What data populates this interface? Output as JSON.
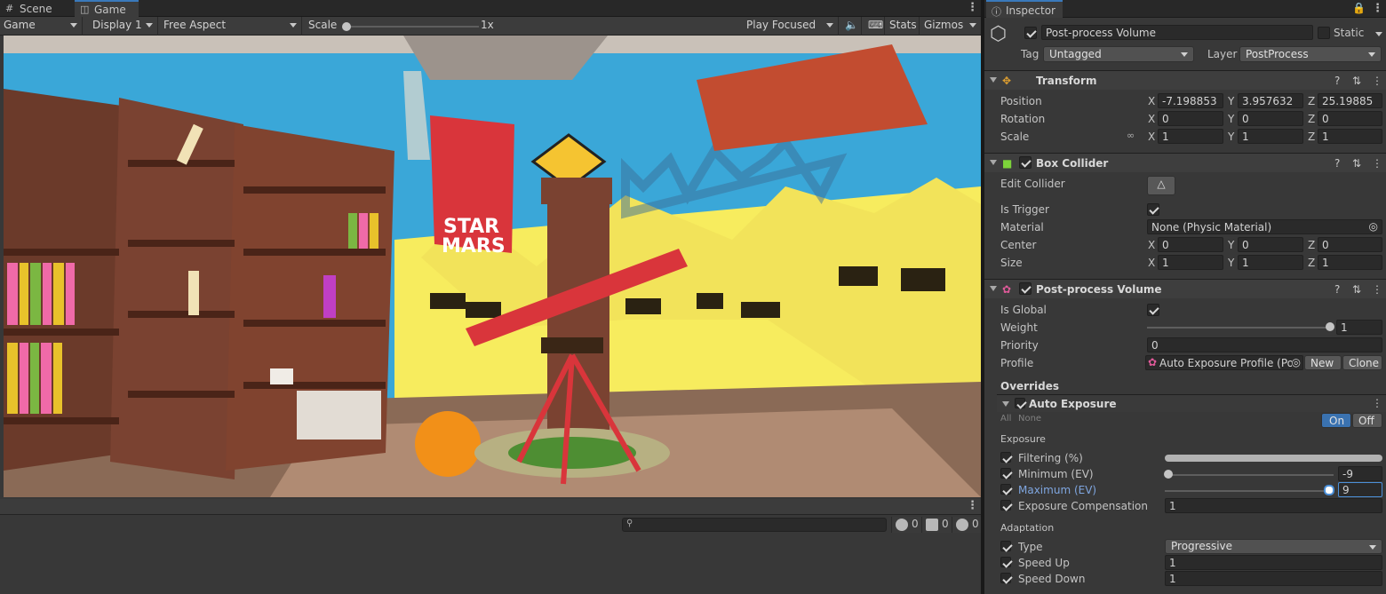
{
  "tabs": [
    {
      "label": "Scene",
      "icon": "grid-icon"
    },
    {
      "label": "Game",
      "icon": "gamepad-icon"
    }
  ],
  "game_toolbar": {
    "display_mode": "Game",
    "display": "Display 1",
    "aspect": "Free Aspect",
    "scale_label": "Scale",
    "scale_value": "1x",
    "play_mode": "Play Focused",
    "stats": "Stats",
    "gizmos": "Gizmos"
  },
  "scene": {
    "banner_line1": "STAR",
    "banner_line2": "MARS"
  },
  "console": {
    "search_placeholder": "",
    "log_count": "0",
    "warning_count": "0",
    "error_count": "0"
  },
  "inspector": {
    "tab": "Inspector",
    "object": {
      "name": "Post-process Volume",
      "static_label": "Static",
      "tag_label": "Tag",
      "tag": "Untagged",
      "layer_label": "Layer",
      "layer": "PostProcess"
    },
    "transform": {
      "title": "Transform",
      "position_label": "Position",
      "rotation_label": "Rotation",
      "scale_label": "Scale",
      "position": {
        "x": "-7.198853",
        "y": "3.957632",
        "z": "25.19885"
      },
      "rotation": {
        "x": "0",
        "y": "0",
        "z": "0"
      },
      "scale": {
        "x": "1",
        "y": "1",
        "z": "1"
      }
    },
    "axes": {
      "x": "X",
      "y": "Y",
      "z": "Z"
    },
    "box_collider": {
      "title": "Box Collider",
      "edit_label": "Edit Collider",
      "trigger_label": "Is Trigger",
      "material_label": "Material",
      "material": "None (Physic Material)",
      "center_label": "Center",
      "size_label": "Size",
      "center": {
        "x": "0",
        "y": "0",
        "z": "0"
      },
      "size": {
        "x": "1",
        "y": "1",
        "z": "1"
      }
    },
    "volume": {
      "title": "Post-process Volume",
      "global_label": "Is Global",
      "weight_label": "Weight",
      "weight": "1",
      "priority_label": "Priority",
      "priority": "0",
      "profile_label": "Profile",
      "profile": "Auto Exposure Profile (Po",
      "new_btn": "New",
      "clone_btn": "Clone",
      "overrides": "Overrides",
      "effect": {
        "title": "Auto Exposure",
        "all": "All",
        "none": "None",
        "on": "On",
        "off": "Off",
        "exposure_section": "Exposure",
        "filtering_label": "Filtering (%)",
        "minimum_label": "Minimum (EV)",
        "minimum": "-9",
        "maximum_label": "Maximum (EV)",
        "maximum": "9",
        "comp_label": "Exposure Compensation",
        "comp": "1",
        "adaptation_section": "Adaptation",
        "type_label": "Type",
        "type": "Progressive",
        "speed_up_label": "Speed Up",
        "speed_up": "1",
        "speed_down_label": "Speed Down",
        "speed_down": "1"
      }
    }
  }
}
